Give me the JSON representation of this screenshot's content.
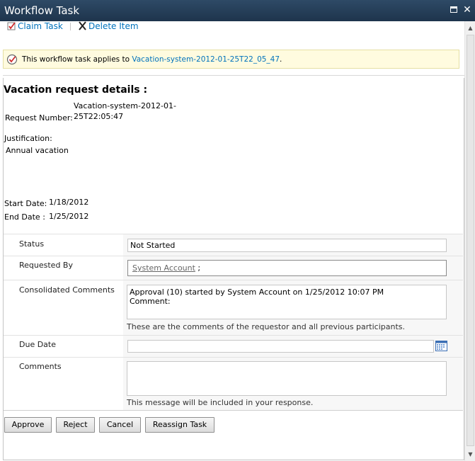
{
  "window": {
    "title": "Workflow Task",
    "restore_icon": "restore-window-icon",
    "close_icon": "close-icon"
  },
  "toolbar": {
    "claim_label": "Claim Task",
    "claim_icon": "claim-task-icon",
    "delete_label": "Delete Item",
    "delete_icon": "delete-x-icon"
  },
  "notice": {
    "icon": "workflow-task-icon",
    "text": "This workflow task applies to ",
    "link": "Vacation-system-2012-01-25T22_05_47",
    "suffix": "."
  },
  "details": {
    "heading": "Vacation request details :",
    "request_number_label": "Request Number:",
    "request_number_line1": "Vacation-system-2012-01-",
    "request_number_line2": "25T22:05:47",
    "justification_label": "Justification:",
    "justification_value": "Annual vacation",
    "start_date_label": "Start Date:",
    "start_date_value": "1/18/2012",
    "end_date_label": "End Date  :",
    "end_date_value": "1/25/2012"
  },
  "form": {
    "status_label": "Status",
    "status_value": "Not Started",
    "requested_by_label": "Requested By",
    "requested_by_value": "System Account",
    "requested_by_sep": " ;",
    "consolidated_label": "Consolidated Comments",
    "consolidated_line1": "Approval (10) started by System Account on 1/25/2012 10:07 PM",
    "consolidated_line2": "Comment:",
    "consolidated_hint": "These are the comments of the requestor and all previous participants.",
    "due_date_label": "Due Date",
    "due_date_value": "",
    "calendar_icon": "calendar-icon",
    "comments_label": "Comments",
    "comments_value": "",
    "comments_hint": "This message will be included in your response."
  },
  "buttons": {
    "approve": "Approve",
    "reject": "Reject",
    "cancel": "Cancel",
    "reassign": "Reassign Task"
  },
  "colors": {
    "title_bar": "#1e344c",
    "link": "#0072bc",
    "notice_bg": "#fffbdf"
  }
}
